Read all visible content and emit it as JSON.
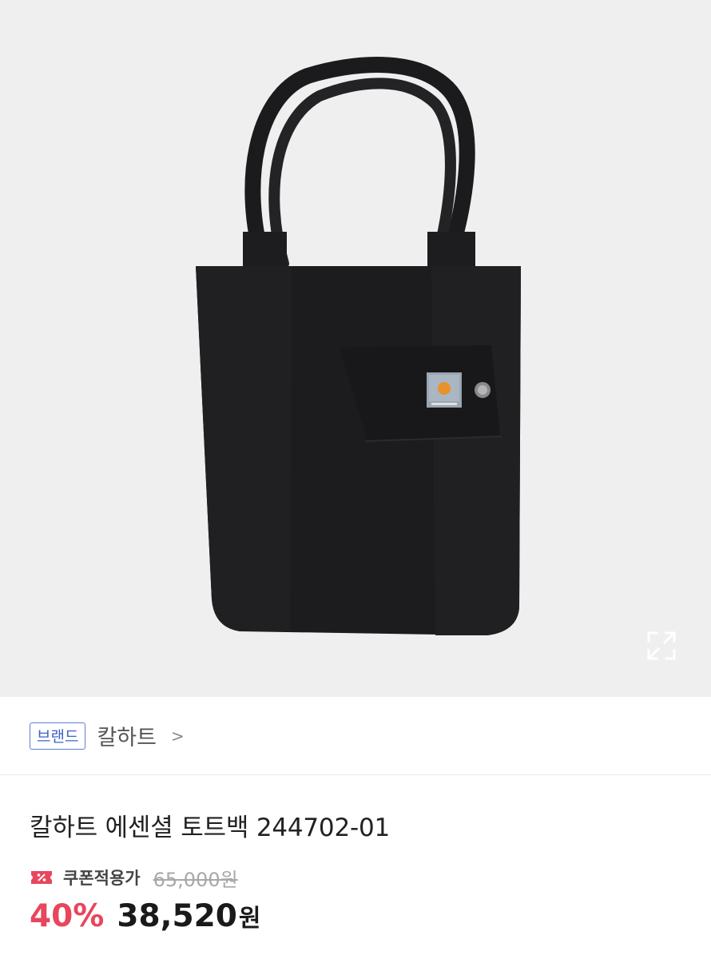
{
  "image": {
    "alt": "product-photo"
  },
  "brand": {
    "badge_label": "브랜드",
    "name": "칼하트",
    "chevron": ">"
  },
  "product": {
    "title": "칼하트 에센셜 토트백 244702-01"
  },
  "price": {
    "coupon_label": "쿠폰적용가",
    "original_price": "65,000원",
    "discount_rate": "40%",
    "sale_price": "38,520",
    "currency_unit": "원"
  },
  "colors": {
    "accent_red": "#e8465d",
    "brand_blue": "#3d63c6",
    "bag_black": "#1c1c1e"
  },
  "icons": {
    "expand": "expand-icon",
    "coupon": "coupon-icon"
  }
}
